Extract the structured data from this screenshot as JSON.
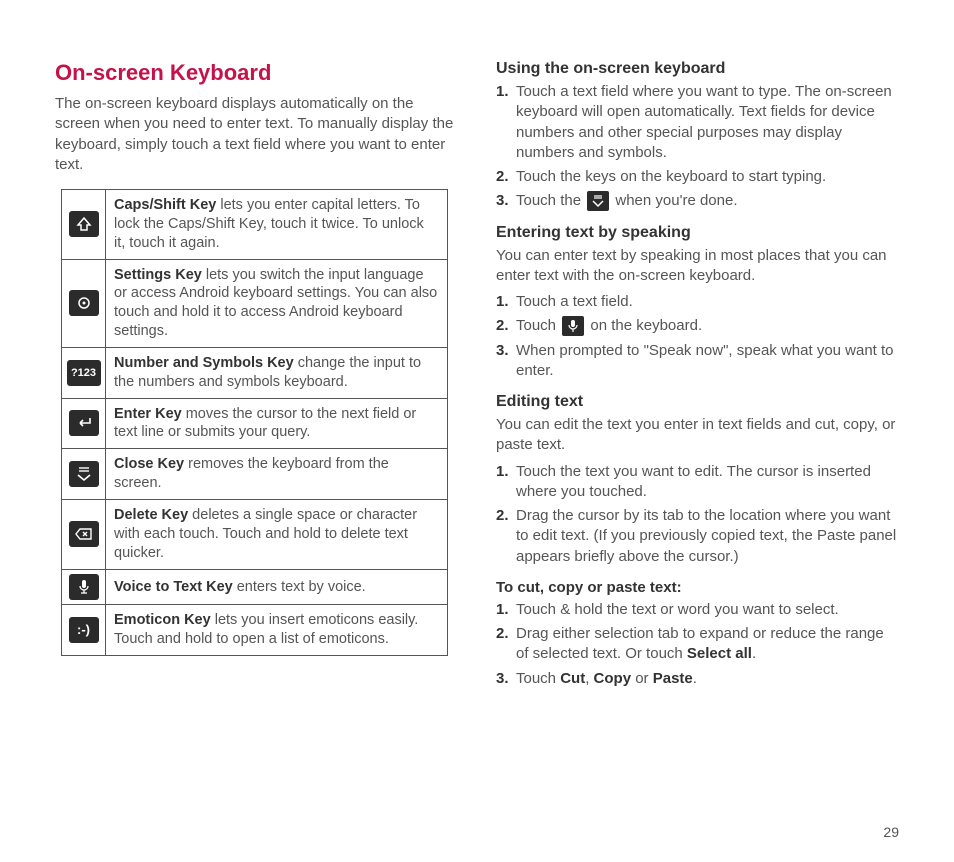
{
  "page_number": "29",
  "left": {
    "title": "On-screen Keyboard",
    "intro": "The on-screen keyboard displays automatically on the screen when you need to enter text. To manually display the keyboard, simply touch a text field where you want to enter text.",
    "keys": [
      {
        "icon": "shift-icon",
        "name": "Caps/Shift Key",
        "desc": " lets you enter capital letters. To lock the Caps/Shift Key, touch it twice. To unlock it, touch it again."
      },
      {
        "icon": "settings-icon",
        "name": "Settings Key",
        "desc": " lets you switch the input language or access Android keyboard settings. You can also touch and hold it to access Android keyboard settings."
      },
      {
        "icon": "numsym-icon",
        "name": "Number and Symbols Key",
        "desc": " change the input to the numbers and symbols keyboard."
      },
      {
        "icon": "enter-icon",
        "name": "Enter Key",
        "desc": " moves the cursor to the next field or text line or submits your query."
      },
      {
        "icon": "close-icon",
        "name": "Close Key",
        "desc": " removes the keyboard from the screen."
      },
      {
        "icon": "delete-icon",
        "name": "Delete Key",
        "desc": " deletes a single space or character with each touch. Touch and hold to delete text quicker."
      },
      {
        "icon": "mic-icon",
        "name": "Voice to Text Key",
        "desc": " enters text by voice."
      },
      {
        "icon": "emoticon-icon",
        "name": "Emoticon Key",
        "desc": " lets you insert emoticons easily. Touch and hold to open a list of emoticons."
      }
    ],
    "numsym_label": "?123",
    "emoticon_label": ":-)"
  },
  "right": {
    "s1": {
      "title": "Using the on-screen keyboard",
      "items": [
        "Touch a text field where you want to type. The on-screen keyboard will open automatically. Text fields for device numbers and other special purposes may display numbers and symbols.",
        "Touch the keys on the keyboard to start typing."
      ],
      "item3_pre": "Touch the ",
      "item3_post": " when you're done."
    },
    "s2": {
      "title": "Entering text by speaking",
      "intro": "You can enter text by speaking in most places that you can enter text with the on-screen keyboard.",
      "item1": "Touch a text field.",
      "item2_pre": "Touch ",
      "item2_post": " on the keyboard.",
      "item3": "When prompted to \"Speak now\", speak what you want to enter."
    },
    "s3": {
      "title": "Editing text",
      "intro": "You can edit the text you enter in text fields and cut, copy, or paste text.",
      "items_a": [
        "Touch the text you want to edit. The cursor is inserted where you touched.",
        "Drag the cursor by its tab to the location where you want to edit text. (If you previously copied text, the Paste panel appears briefly above the cursor.)"
      ],
      "sub": "To cut, copy or paste text:",
      "b1": "Touch & hold the text or word you want to select.",
      "b2_pre": "Drag either selection tab to expand or reduce the range of selected text. Or touch ",
      "b2_bold": "Select all",
      "b2_post": ".",
      "b3_pre": "Touch ",
      "b3_b1": "Cut",
      "b3_s1": ", ",
      "b3_b2": "Copy",
      "b3_s2": " or ",
      "b3_b3": "Paste",
      "b3_post": "."
    }
  }
}
